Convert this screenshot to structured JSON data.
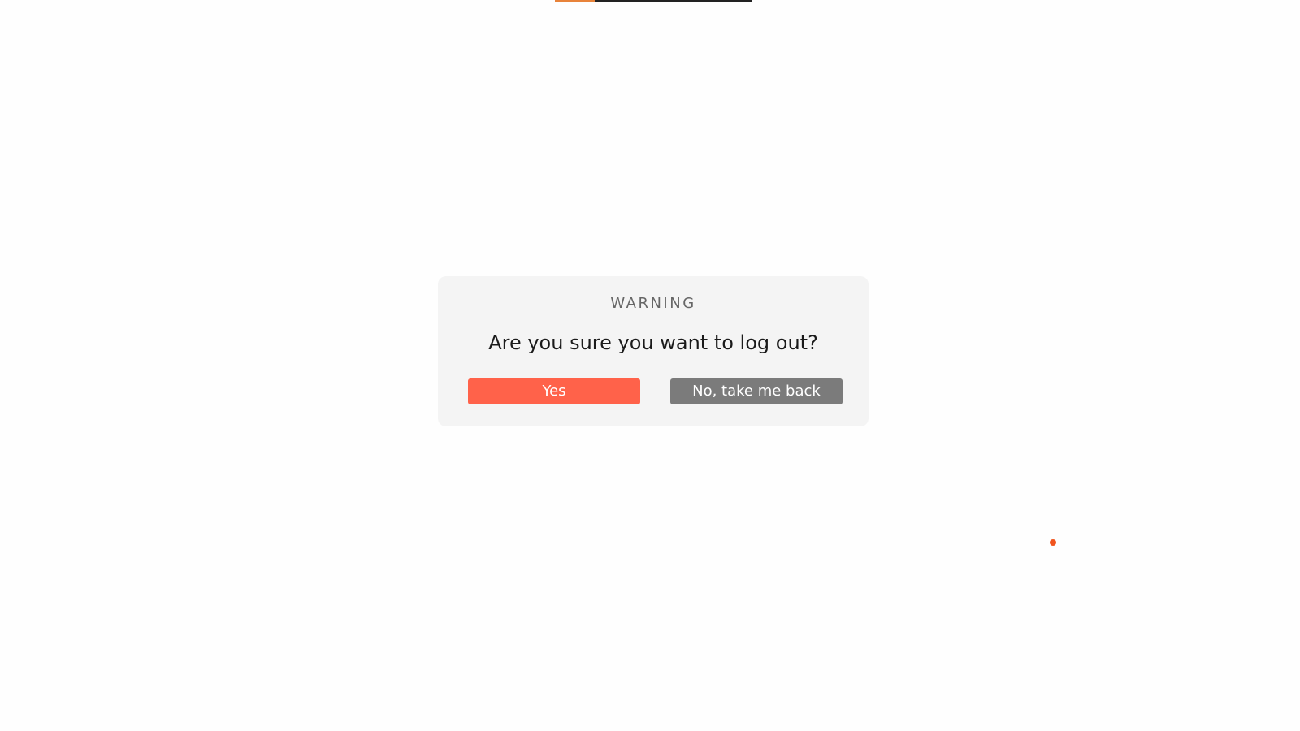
{
  "top_progress": {
    "value": 0.2,
    "track_color": "#222222",
    "fill_color": "#e8833a"
  },
  "modal": {
    "title": "WARNING",
    "message": "Are you sure you want to log out?",
    "confirm_label": "Yes",
    "cancel_label": "No, take me back"
  },
  "colors": {
    "confirm": "#ff624a",
    "cancel": "#7b7b7b",
    "dot": "#f0541e"
  }
}
